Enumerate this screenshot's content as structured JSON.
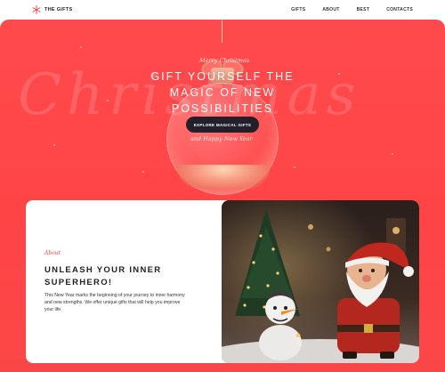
{
  "brand": {
    "name": "THE GIFTS",
    "icon": "snowflake-icon",
    "accent": "#f0474c"
  },
  "nav": {
    "items": [
      "GIFTS",
      "ABOUT",
      "BEST",
      "CONTACTS"
    ]
  },
  "hero": {
    "background_word": "Christmas",
    "script_top": "Merry Christmas",
    "headline": "GIFT YOURSELF THE MAGIC OF NEW POSSIBILITIES",
    "cta_label": "EXPLORE MAGICAL GIFTS",
    "script_bottom": "and Happy New Year",
    "background_color": "#ff4a4d"
  },
  "about": {
    "label": "About",
    "title": "UNLEASH YOUR INNER SUPERHERO!",
    "text": "This New Year marks the beginning of your journey to inner harmony and new strengths. We offer unique gifts that will help you improve your life."
  }
}
